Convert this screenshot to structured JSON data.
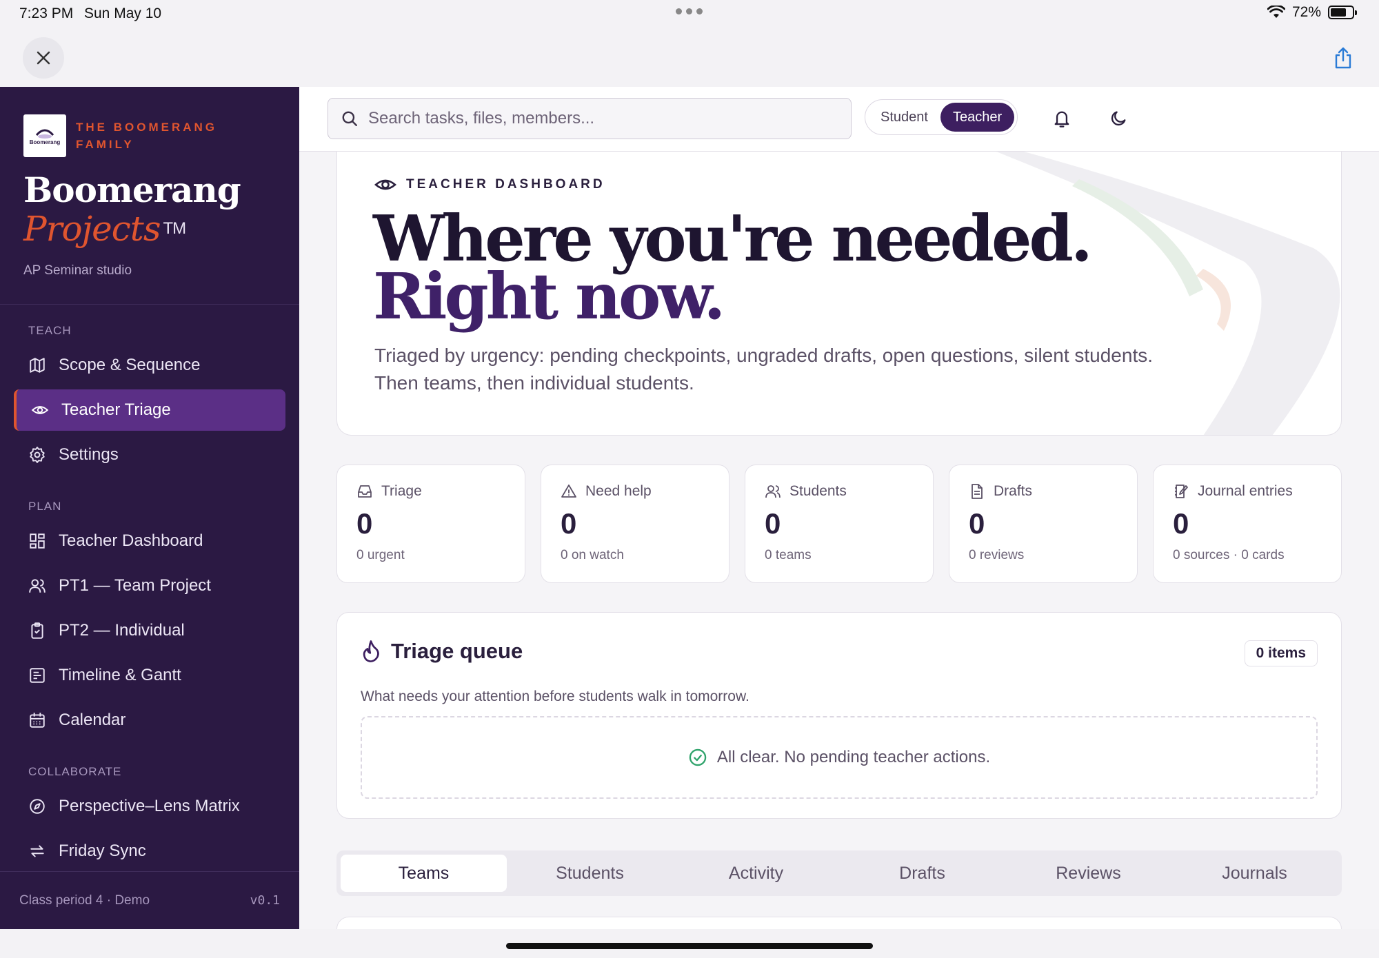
{
  "status_bar": {
    "time": "7:23 PM",
    "date": "Sun May 10",
    "battery": "72%",
    "battery_level": 0.72
  },
  "chrome": {
    "close_icon": "close-icon",
    "share_icon": "share-icon"
  },
  "sidebar": {
    "org": "THE BOOMERANG FAMILY",
    "logo_text": "Boomerang",
    "title": "Boomerang",
    "subtitle": "Projects",
    "trademark": "TM",
    "caption": "AP Seminar studio",
    "sections": [
      {
        "heading": "TEACH",
        "items": [
          {
            "label": "Scope & Sequence",
            "icon": "map-icon"
          },
          {
            "label": "Teacher Triage",
            "icon": "eye-icon",
            "active": true
          },
          {
            "label": "Settings",
            "icon": "gear-icon"
          }
        ]
      },
      {
        "heading": "PLAN",
        "items": [
          {
            "label": "Teacher Dashboard",
            "icon": "dashboard-icon"
          },
          {
            "label": "PT1 — Team Project",
            "icon": "users-icon"
          },
          {
            "label": "PT2 — Individual",
            "icon": "clipboard-icon"
          },
          {
            "label": "Timeline & Gantt",
            "icon": "timeline-icon"
          },
          {
            "label": "Calendar",
            "icon": "calendar-icon"
          }
        ]
      },
      {
        "heading": "COLLABORATE",
        "items": [
          {
            "label": "Perspective–Lens Matrix",
            "icon": "compass-icon"
          },
          {
            "label": "Friday Sync",
            "icon": "sync-icon"
          }
        ]
      }
    ],
    "footer": {
      "class_label": "Class period 4 · Demo",
      "version": "v0.1"
    }
  },
  "topbar": {
    "search_placeholder": "Search tasks, files, members...",
    "role_student": "Student",
    "role_teacher": "Teacher",
    "active_role": "Teacher",
    "bell_icon": "bell-icon",
    "theme_icon": "moon-icon"
  },
  "hero": {
    "kicker": "TEACHER DASHBOARD",
    "title_line1": "Where you're needed.",
    "title_line2": "Right now.",
    "description": "Triaged by urgency: pending checkpoints, ungraded drafts, open questions, silent students. Then teams, then individual students."
  },
  "stats": [
    {
      "label": "Triage",
      "value": "0",
      "sub": "0 urgent",
      "icon": "inbox-icon"
    },
    {
      "label": "Need help",
      "value": "0",
      "sub": "0 on watch",
      "icon": "warning-icon"
    },
    {
      "label": "Students",
      "value": "0",
      "sub": "0 teams",
      "icon": "users-icon"
    },
    {
      "label": "Drafts",
      "value": "0",
      "sub": "0 reviews",
      "icon": "document-icon"
    },
    {
      "label": "Journal entries",
      "value": "0",
      "sub": "0 sources · 0 cards",
      "icon": "journal-icon"
    }
  ],
  "queue": {
    "title": "Triage queue",
    "count": "0 items",
    "description": "What needs your attention before students walk in tomorrow.",
    "empty_message": "All clear. No pending teacher actions."
  },
  "tabs": [
    {
      "label": "Teams",
      "active": true
    },
    {
      "label": "Students"
    },
    {
      "label": "Activity"
    },
    {
      "label": "Drafts"
    },
    {
      "label": "Reviews"
    },
    {
      "label": "Journals"
    }
  ],
  "colors": {
    "sidebar_bg": "#2b1943",
    "accent": "#e0552f",
    "active_nav": "#5b2f86",
    "teacher_pill": "#3d1f60",
    "success": "#2fa36b"
  }
}
